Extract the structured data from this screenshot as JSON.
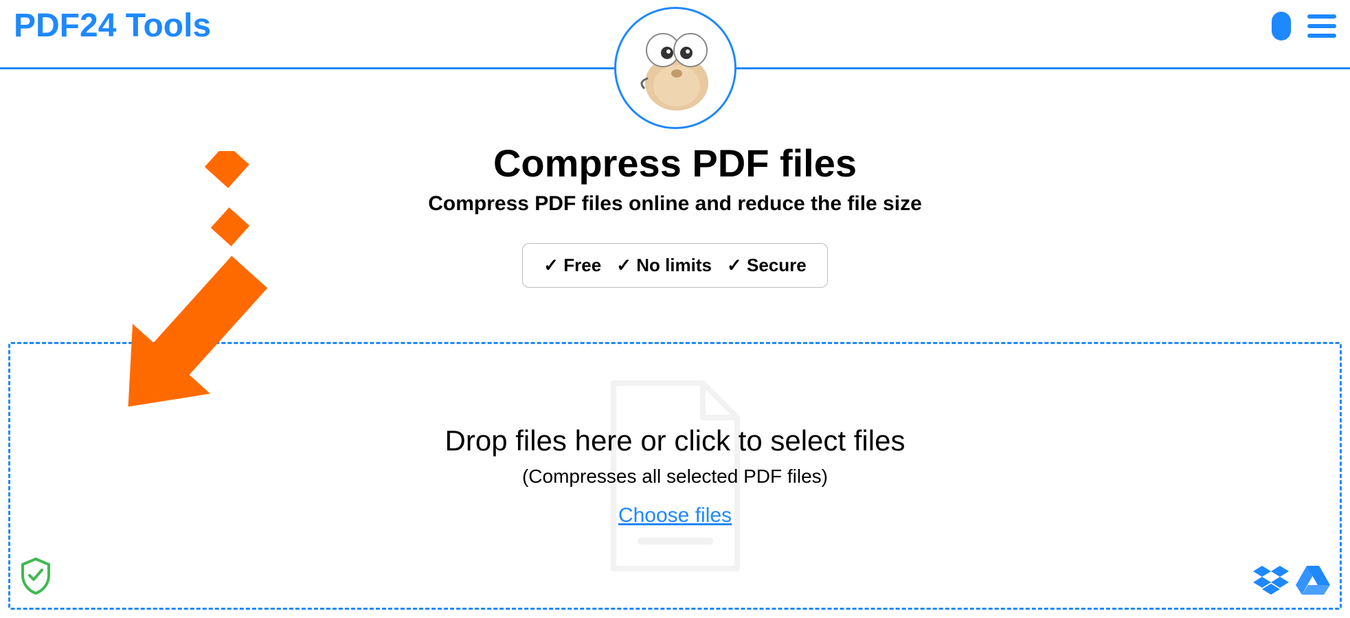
{
  "header": {
    "brand": "PDF24 Tools"
  },
  "page": {
    "title": "Compress PDF files",
    "subtitle": "Compress PDF files online and reduce the file size",
    "features": [
      "✓ Free",
      "✓ No limits",
      "✓ Secure"
    ]
  },
  "dropzone": {
    "main_text": "Drop files here or click to select files",
    "sub_text": "(Compresses all selected PDF files)",
    "choose_text": "Choose files"
  },
  "icons": {
    "mascot": "sheep-mascot",
    "shield": "shield-check",
    "dropbox": "dropbox",
    "gdrive": "google-drive"
  }
}
